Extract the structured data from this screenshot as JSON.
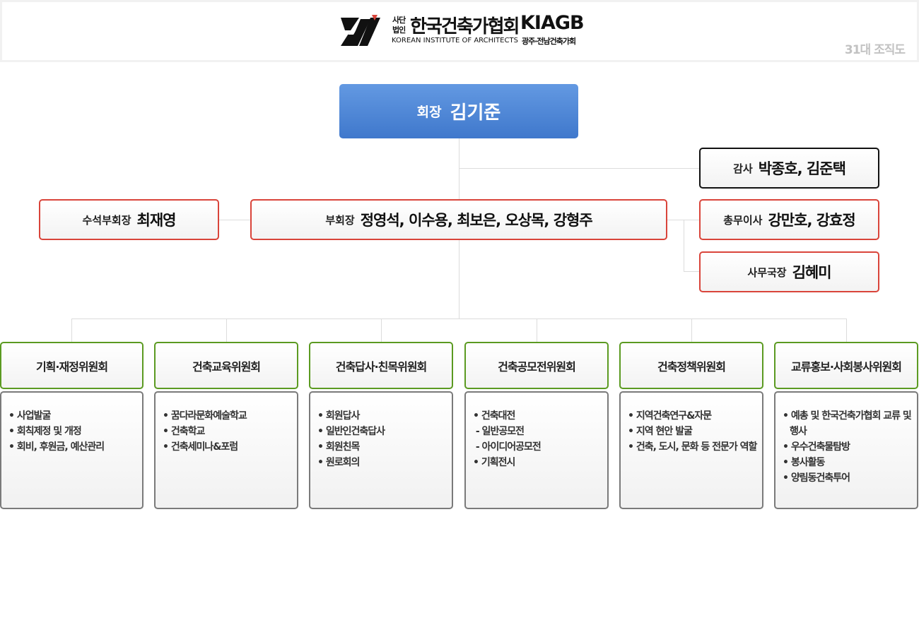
{
  "header": {
    "logo_small": "사단법인",
    "logo_korean": "한국건축가협회",
    "logo_english": "KOREAN INSTITUTE OF ARCHITECTS",
    "logo_abbr": "KIAGB",
    "logo_branch": "광주·전남건축가회",
    "caption": "31대 조직도"
  },
  "president": {
    "role": "회장",
    "name": "김기준"
  },
  "auditor": {
    "role": "감사",
    "name": "박종호, 김준택"
  },
  "senior_vp": {
    "role": "수석부회장",
    "name": "최재영"
  },
  "vice_presidents": {
    "role": "부회장",
    "name": "정영석, 이수용, 최보은, 오상목, 강형주"
  },
  "general_affairs": {
    "role": "총무이사",
    "name": "강만호, 강효정"
  },
  "secretary_general": {
    "role": "사무국장",
    "name": "김혜미"
  },
  "committees": [
    {
      "title": "기획·재정위원회",
      "items": [
        "• 사업발굴",
        "• 회칙제정 및 개정",
        "• 회비, 후원금, 예산관리"
      ]
    },
    {
      "title": "건축교육위원회",
      "items": [
        "• 꿈다라문화예술학교",
        "• 건축학교",
        "• 건축세미나&포럼"
      ]
    },
    {
      "title": "건축답사·친목위원회",
      "items": [
        "• 회원답사",
        "• 일반인건축답사",
        "• 회원친목",
        "• 원로회의"
      ]
    },
    {
      "title": "건축공모전위원회",
      "items": [
        "• 건축대전",
        " - 일반공모전",
        " - 아이디어공모전",
        "• 기획전시"
      ]
    },
    {
      "title": "건축정책위원회",
      "items": [
        "• 지역건축연구&자문",
        "• 지역 현안 발굴",
        "• 건축, 도시, 문화 등 전문가 역할"
      ]
    },
    {
      "title": "교류홍보·사회봉사위원회",
      "items": [
        "• 예총 및 한국건축가협회 교류 및 행사",
        "• 우수건축물탐방",
        "• 봉사활동",
        "• 양림동건축투어"
      ]
    }
  ]
}
